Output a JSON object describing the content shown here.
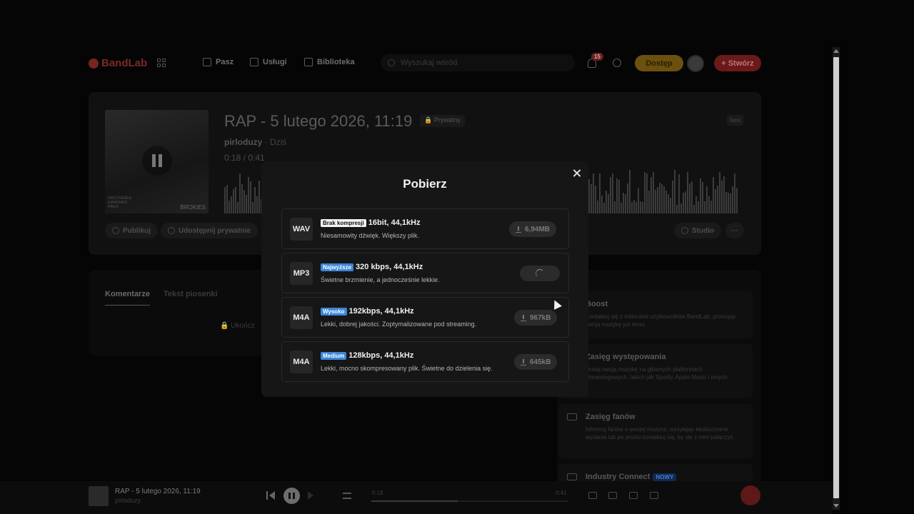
{
  "header": {
    "logo": "BandLab",
    "nav": [
      {
        "label": "Pasz",
        "icon": "home-icon"
      },
      {
        "label": "Usługi",
        "icon": "star-icon"
      },
      {
        "label": "Biblioteka",
        "icon": "library-icon"
      }
    ],
    "search_placeholder": "Wyszukaj wśród",
    "notifications_count": "15",
    "access_label": "Dostęp",
    "create_label": "+ Stwórz"
  },
  "track": {
    "title": "RAP - 5 lutego 2026, 11:19",
    "privacy": "Prywatny",
    "artist": "pirloduzy",
    "date": "Dziś",
    "time_current": "0:18",
    "time_total": "0:41",
    "lang_tag": "fans",
    "cover_caption_left": "DISCOVERED DIAMONDS PIRLO",
    "cover_caption_right": "BROKIES",
    "actions": [
      "Publikuj",
      "Udostępnij prywatnie"
    ],
    "studio_label": "Studio"
  },
  "comments": {
    "tabs": [
      "Komentarze",
      "Tekst piosenki"
    ],
    "locked_note": "Ukończ"
  },
  "promo": [
    {
      "title": "Boost",
      "desc": "Kontaktuj się z milionami użytkowników BandLab, promując swoją muzykę już teraz."
    },
    {
      "title": "Zasięg występowania",
      "desc": "Dodaj swoją muzykę na głównych platformach streamingowych, takich jak Spotify, Apple Music i innych."
    },
    {
      "title": "Zasięg fanów",
      "desc": "Informuj fanów o swojej muzyce, wysyłając ekskluzywne wydania lub po prostu kontaktuj się, by się z nimi połączyć."
    },
    {
      "title": "Industry Connect",
      "badge": "NOWY"
    }
  ],
  "player": {
    "title": "RAP - 5 lutego 2026, 11:19",
    "artist": "pirloduzy",
    "time_current": "0:18",
    "time_total": "0:41",
    "progress": 0.44
  },
  "modal": {
    "title": "Pobierz",
    "options": [
      {
        "format": "WAV",
        "tag": "Brak kompresji",
        "tag_style": "white",
        "spec": "16bit, 44,1kHz",
        "desc": "Niesamowity dźwięk. Większy plik.",
        "size": "6,94MB",
        "loading": false
      },
      {
        "format": "MP3",
        "tag": "Najwyższe",
        "tag_style": "blue",
        "spec": "320 kbps, 44,1kHz",
        "desc": "Świetne brzmienie, a jednocześnie lekkie.",
        "size": "",
        "loading": true
      },
      {
        "format": "M4A",
        "tag": "Wysoko",
        "tag_style": "blue",
        "spec": "192kbps, 44,1kHz",
        "desc": "Lekki, dobrej jakości. Zoptymalizowane pod streaming.",
        "size": "967kB",
        "loading": false
      },
      {
        "format": "M4A",
        "tag": "Medium",
        "tag_style": "blue",
        "spec": "128kbps, 44,1kHz",
        "desc": "Lekki, mocno skompresowany plik. Świetne do dzielenia się.",
        "size": "645kB",
        "loading": false
      }
    ]
  },
  "colors": {
    "modal_bg": "#161616",
    "tag_blue": "#3c86d8",
    "brand_red": "#e03a2f"
  }
}
